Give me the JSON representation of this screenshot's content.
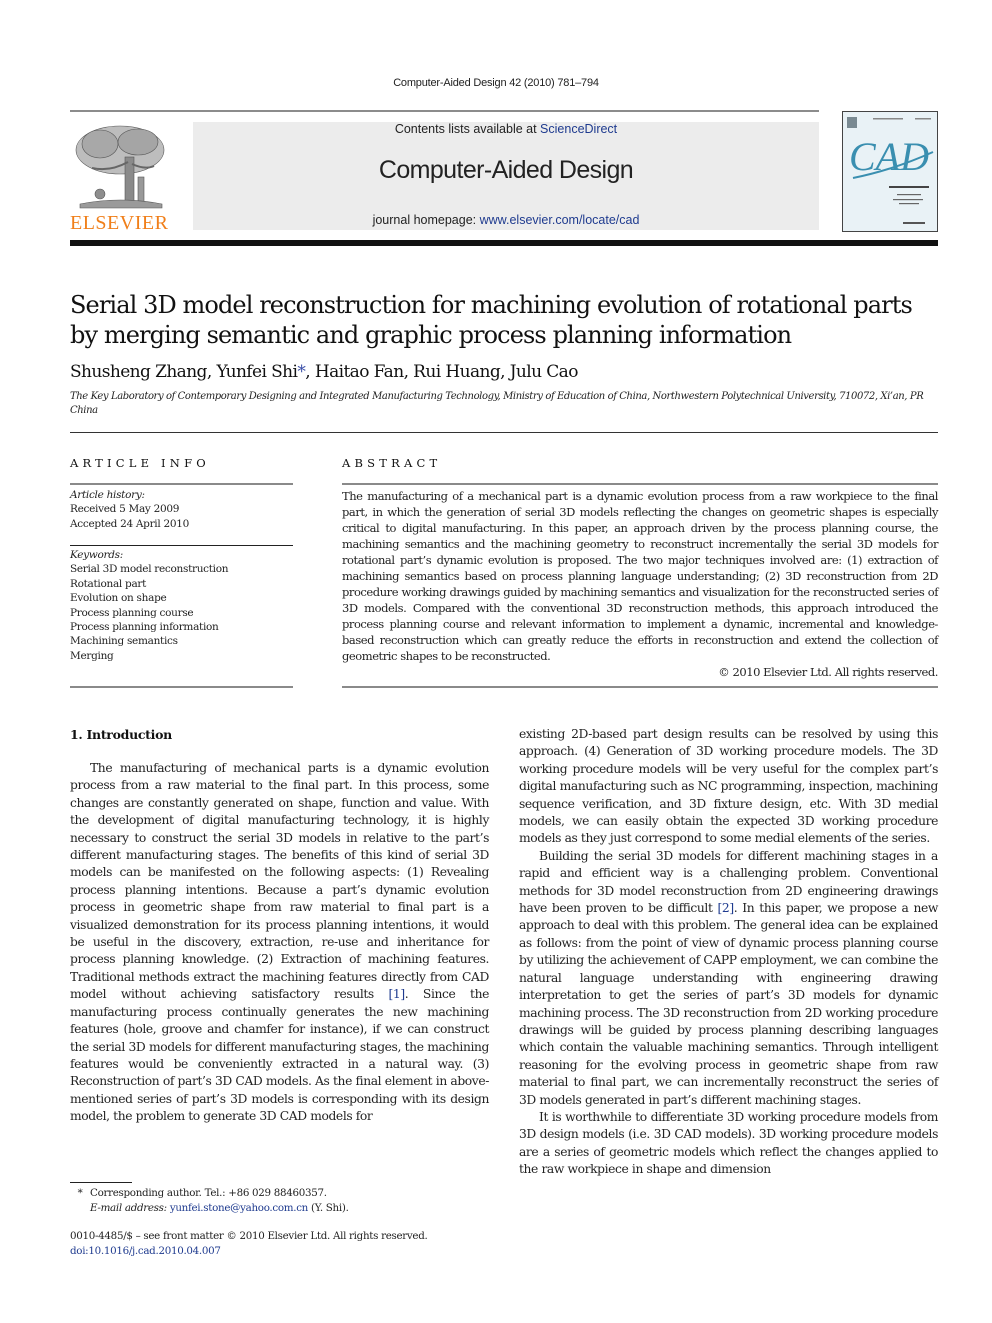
{
  "running_head": "Computer-Aided Design 42 (2010) 781–794",
  "header": {
    "contents_prefix": "Contents lists available at ",
    "contents_link": "ScienceDirect",
    "journal_title": "Computer-Aided Design",
    "homepage_prefix": "journal homepage: ",
    "homepage_link": "www.elsevier.com/locate/cad",
    "publisher_logo_text": "ELSEVIER",
    "cover_text": "CAD",
    "colors": {
      "publisher_orange": "#f07f1a",
      "link_blue": "#1f3b8f",
      "cover_teal": "#3a8fb0"
    }
  },
  "article": {
    "title": "Serial 3D model reconstruction for machining evolution of rotational parts by merging semantic and graphic process planning information",
    "authors_before_star": "Shusheng Zhang, Yunfei Shi",
    "star": "*",
    "authors_after_star": ", Haitao Fan, Rui Huang, Julu Cao",
    "affiliation": "The Key Laboratory of Contemporary Designing and Integrated Manufacturing Technology, Ministry of Education of China, Northwestern Polytechnical University, 710072, Xi’an, PR China"
  },
  "article_info": {
    "heading": "ARTICLE INFO",
    "history_label": "Article history:",
    "received": "Received 5 May 2009",
    "accepted": "Accepted 24 April 2010",
    "keywords_label": "Keywords:",
    "keywords": [
      "Serial 3D model reconstruction",
      "Rotational part",
      "Evolution on shape",
      "Process planning course",
      "Process planning information",
      "Machining semantics",
      "Merging"
    ]
  },
  "abstract": {
    "heading": "ABSTRACT",
    "text": "The manufacturing of a mechanical part is a dynamic evolution process from a raw workpiece to the final part, in which the generation of serial 3D models reflecting the changes on geometric shapes is especially critical to digital manufacturing. In this paper, an approach driven by the process planning course, the machining semantics and the machining geometry to reconstruct incrementally the serial 3D models for rotational part’s dynamic evolution is proposed. The two major techniques involved are: (1) extraction of machining semantics based on process planning language understanding; (2) 3D reconstruction from 2D procedure working drawings guided by machining semantics and visualization for the reconstructed series of 3D models. Compared with the conventional 3D reconstruction methods, this approach introduced the process planning course and relevant information to implement a dynamic, incremental and knowledge-based reconstruction which can greatly reduce the efforts in reconstruction and extend the collection of geometric shapes to be reconstructed.",
    "copyright": "© 2010 Elsevier Ltd. All rights reserved."
  },
  "body": {
    "section_heading": "1.  Introduction",
    "left_p1_before_ref": "The manufacturing of mechanical parts is a dynamic evolution process from a raw material to the final part. In this process, some changes are constantly generated on shape, function and value. With the development of digital manufacturing technology, it is highly necessary to construct the serial 3D models in relative to the part’s different manufacturing stages. The benefits of this kind of serial 3D models can be manifested on the following aspects: (1) Revealing process planning intentions. Because a part’s dynamic evolution process in geometric shape from raw material to final part is a visualized demonstration for its process planning intentions, it would be useful in the discovery, extraction, re-use and inheritance for process planning knowledge. (2) Extraction of machining features. Traditional methods extract the machining features directly from CAD model without achieving satisfactory results ",
    "ref1": "[1]",
    "left_p1_after_ref": ". Since the manufacturing process continually generates the new machining features (hole, groove and chamfer for instance), if we can construct the serial 3D models for different manufacturing stages, the machining features would be conveniently extracted in a natural way. (3) Reconstruction of part’s 3D CAD models. As the final element in above-mentioned series of part’s 3D models is corresponding with its design model, the problem to generate 3D CAD models for",
    "right_p0": "existing 2D-based part design results can be resolved by using this approach. (4) Generation of 3D working procedure models. The 3D working procedure models will be very useful for the complex part’s digital manufacturing such as NC programming, inspection, machining sequence verification, and 3D fixture design, etc. With 3D medial models, we can easily obtain the expected 3D working procedure models as they just correspond to some medial elements of the series.",
    "right_p1_before_ref": "Building the serial 3D models for different machining stages in a rapid and efficient way is a challenging problem. Conventional methods for 3D model reconstruction from 2D engineering drawings have been proven to be difficult ",
    "ref2": "[2]",
    "right_p1_after_ref": ". In this paper, we propose a new approach to deal with this problem. The general idea can be explained as follows: from the point of view of dynamic process planning course by utilizing the achievement of CAPP employment, we can combine the natural language understanding with engineering drawing interpretation to get the series of part’s 3D models for dynamic machining process. The 3D reconstruction from 2D working procedure drawings will be guided by process planning describing languages which contain the valuable machining semantics. Through intelligent reasoning for the evolving process in geometric shape from raw material to final part, we can incrementally reconstruct the series of 3D models generated in part’s different machining stages.",
    "right_p2": "It is worthwhile to differentiate 3D working procedure models from 3D design models (i.e. 3D CAD models). 3D working procedure models are a series of geometric models which reflect the changes applied to the raw workpiece in shape and dimension"
  },
  "footnote": {
    "star": "*",
    "corresponding": "Corresponding author. Tel.: +86 029 88460357.",
    "email_label": "E-mail address: ",
    "email": "yunfei.stone@yahoo.com.cn",
    "email_suffix": " (Y. Shi)."
  },
  "front_matter": {
    "issn_line": "0010-4485/$ – see front matter © 2010 Elsevier Ltd. All rights reserved.",
    "doi": "doi:10.1016/j.cad.2010.04.007"
  }
}
